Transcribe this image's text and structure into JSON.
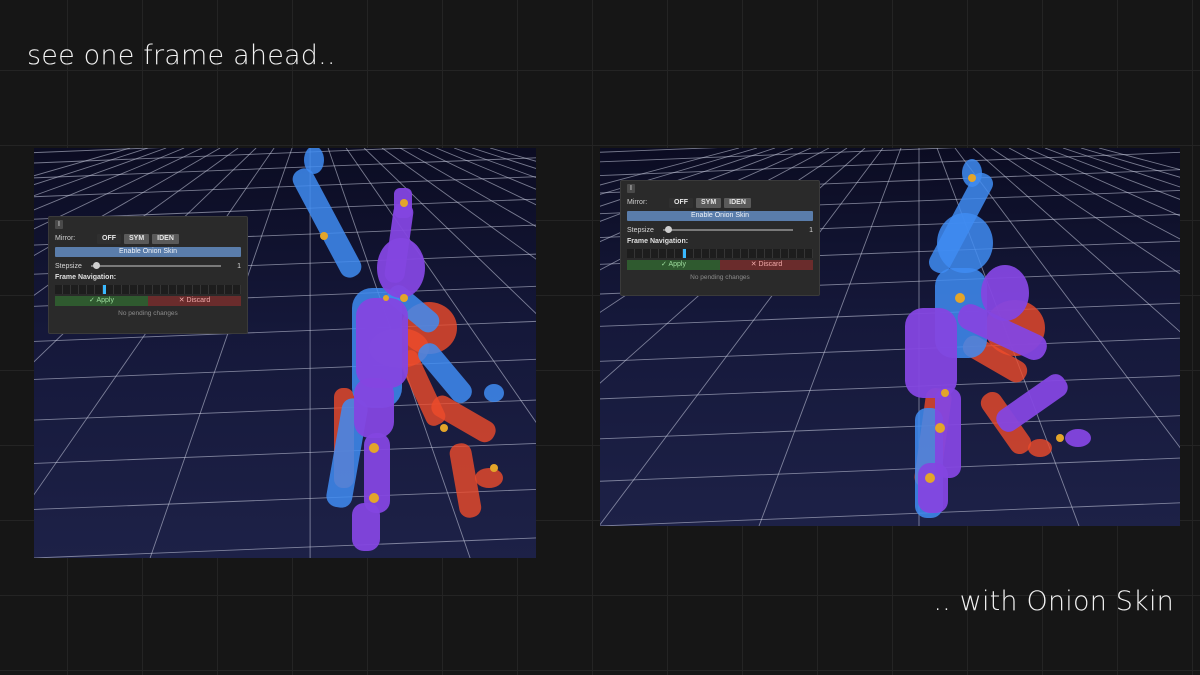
{
  "captions": {
    "top": "see one frame ahead..",
    "bottom": ".. with Onion Skin"
  },
  "panel": {
    "tab_label": "I",
    "mirror_label": "Mirror:",
    "mirror_options": [
      "OFF",
      "SYM",
      "IDEN"
    ],
    "enable_button": "Enable Onion Skin",
    "stepsize_label": "Stepsize",
    "stepsize_value": "1",
    "frame_nav_label": "Frame Navigation:",
    "apply_label": "✓ Apply",
    "discard_label": "✕ Discard",
    "status_text": "No pending changes"
  },
  "colors": {
    "background": "#161616",
    "viewport_bg": "#15183a",
    "grid_line": "#cfd3e6",
    "figure_blue": "#3f8cf2",
    "figure_purple": "#8446e0",
    "figure_red": "#ee4b2b",
    "joint_gold": "#e3a52a",
    "enable_button": "#5a7dab",
    "apply_green": "#2f5a2f",
    "discard_red": "#6a2c2c"
  },
  "icons": {
    "check": "check-icon",
    "close": "close-icon"
  }
}
